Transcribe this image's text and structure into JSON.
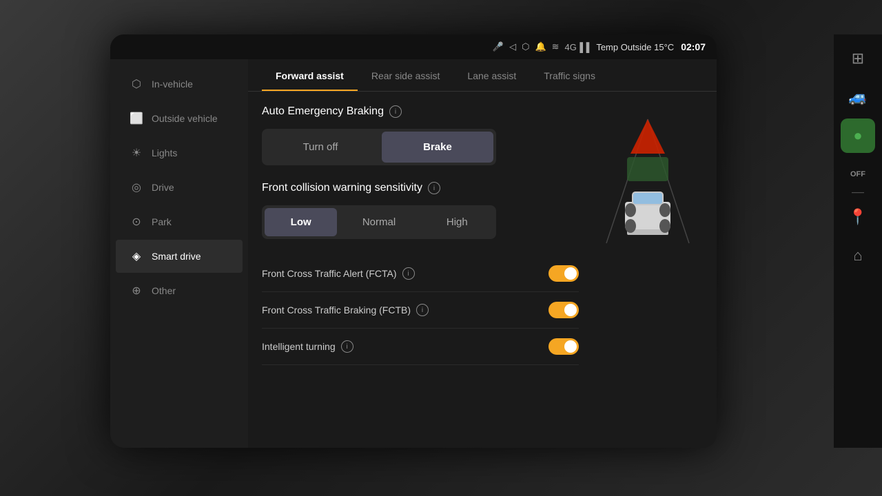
{
  "statusBar": {
    "temp": "Temp Outside 15°C",
    "time": "02:07"
  },
  "sidebar": {
    "items": [
      {
        "id": "in-vehicle",
        "label": "In-vehicle",
        "icon": "🚗"
      },
      {
        "id": "outside-vehicle",
        "label": "Outside vehicle",
        "icon": "🔲"
      },
      {
        "id": "lights",
        "label": "Lights",
        "icon": "☀"
      },
      {
        "id": "drive",
        "label": "Drive",
        "icon": "◎"
      },
      {
        "id": "park",
        "label": "Park",
        "icon": "◎"
      },
      {
        "id": "smart-drive",
        "label": "Smart drive",
        "icon": "◈",
        "active": true
      },
      {
        "id": "other",
        "label": "Other",
        "icon": "◎"
      }
    ]
  },
  "tabs": [
    {
      "id": "forward-assist",
      "label": "Forward assist",
      "active": true
    },
    {
      "id": "rear-side-assist",
      "label": "Rear side assist"
    },
    {
      "id": "lane-assist",
      "label": "Lane assist"
    },
    {
      "id": "traffic-signs",
      "label": "Traffic signs"
    }
  ],
  "content": {
    "autoEmergencyBraking": {
      "title": "Auto Emergency Braking",
      "options": [
        {
          "id": "turn-off",
          "label": "Turn off"
        },
        {
          "id": "brake",
          "label": "Brake",
          "active": true
        }
      ]
    },
    "frontCollisionWarning": {
      "title": "Front collision warning sensitivity",
      "options": [
        {
          "id": "low",
          "label": "Low",
          "active": true
        },
        {
          "id": "normal",
          "label": "Normal"
        },
        {
          "id": "high",
          "label": "High"
        }
      ]
    },
    "toggleRows": [
      {
        "id": "fcta",
        "label": "Front Cross Traffic Alert (FCTA)",
        "enabled": true,
        "hasInfo": true
      },
      {
        "id": "fctb",
        "label": "Front Cross Traffic Braking (FCTB)",
        "enabled": true,
        "hasInfo": true
      },
      {
        "id": "intelligent-turning",
        "label": "Intelligent turning",
        "enabled": true,
        "hasInfo": true
      }
    ]
  },
  "dock": {
    "items": [
      {
        "id": "grid",
        "icon": "⊞",
        "active": false
      },
      {
        "id": "car",
        "icon": "🚙",
        "active": false
      },
      {
        "id": "green-circle",
        "icon": "●",
        "active": true,
        "green": true
      },
      {
        "id": "off",
        "icon": "OFF",
        "active": false,
        "isText": true
      },
      {
        "id": "location",
        "icon": "📍",
        "active": false
      },
      {
        "id": "home",
        "icon": "⌂",
        "active": false
      }
    ]
  }
}
